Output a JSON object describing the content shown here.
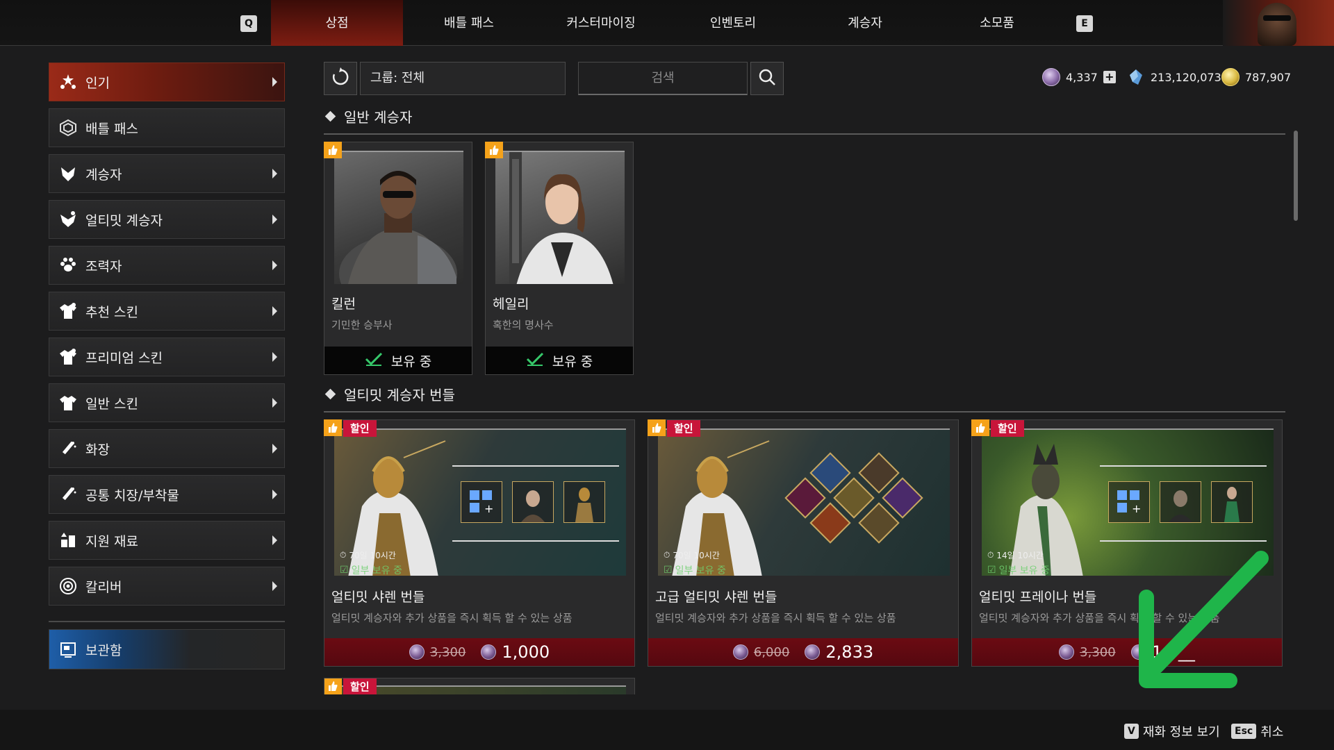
{
  "topbar": {
    "key_left": "Q",
    "key_right": "E",
    "tabs": [
      {
        "label": "상점",
        "active": true
      },
      {
        "label": "배틀 패스",
        "active": false
      },
      {
        "label": "커스터마이징",
        "active": false
      },
      {
        "label": "인벤토리",
        "active": false
      },
      {
        "label": "계승자",
        "active": false
      },
      {
        "label": "소모품",
        "active": false
      }
    ]
  },
  "sidebar": {
    "items": [
      {
        "label": "인기",
        "icon": "star-cluster-icon",
        "active": true,
        "has_arrow": true
      },
      {
        "label": "배틀 패스",
        "icon": "battle-pass-icon",
        "active": false,
        "has_arrow": false
      },
      {
        "label": "계승자",
        "icon": "descendant-icon",
        "active": false,
        "has_arrow": true
      },
      {
        "label": "얼티밋 계승자",
        "icon": "ultimate-descendant-icon",
        "active": false,
        "has_arrow": true
      },
      {
        "label": "조력자",
        "icon": "paw-icon",
        "active": false,
        "has_arrow": true
      },
      {
        "label": "추천 스킨",
        "icon": "shirt-icon",
        "active": false,
        "has_arrow": true
      },
      {
        "label": "프리미엄 스킨",
        "icon": "shirt-icon",
        "active": false,
        "has_arrow": true
      },
      {
        "label": "일반 스킨",
        "icon": "shirt-icon",
        "active": false,
        "has_arrow": true
      },
      {
        "label": "화장",
        "icon": "makeup-brush-icon",
        "active": false,
        "has_arrow": true
      },
      {
        "label": "공통 치장/부착물",
        "icon": "makeup-brush-icon",
        "active": false,
        "has_arrow": true
      },
      {
        "label": "지원 재료",
        "icon": "materials-icon",
        "active": false,
        "has_arrow": true
      },
      {
        "label": "칼리버",
        "icon": "caliber-icon",
        "active": false,
        "has_arrow": true
      }
    ],
    "storage_label": "보관함"
  },
  "toolbar": {
    "group_label": "그룹: 전체",
    "search_placeholder": "검색"
  },
  "currency": [
    {
      "value": "4,337",
      "icon": "caliber-coin-icon",
      "color": "#8a6aa8"
    },
    {
      "value": "213,120,073",
      "icon": "kuiper-shard-icon",
      "color": "#5a9ad8"
    },
    {
      "value": "787,907",
      "icon": "gold-coin-icon",
      "color": "#d8b840"
    }
  ],
  "sections": {
    "general": "일반 계승자",
    "ultimate": "얼티밋 계승자 번들"
  },
  "descendants": [
    {
      "name": "킬런",
      "subtitle": "기민한 승부사",
      "status": "보유 중"
    },
    {
      "name": "헤일리",
      "subtitle": "혹한의 명사수",
      "status": "보유 중"
    }
  ],
  "bundles": [
    {
      "sale_tag": "할인",
      "timer": "70일 10시간",
      "partial": "일부 보유 중",
      "title": "얼티밋 샤렌 번들",
      "desc": "얼티밋 계승자와 추가 상품을 즉시 획득 할 수 있는 상품",
      "old_price": "3,300",
      "new_price": "1,000"
    },
    {
      "sale_tag": "할인",
      "timer": "70일 10시간",
      "partial": "일부 보유 중",
      "title": "고급 얼티밋 샤렌 번들",
      "desc": "얼티밋 계승자와 추가 상품을 즉시 획득 할 수 있는 상품",
      "old_price": "6,000",
      "new_price": "2,833"
    },
    {
      "sale_tag": "할인",
      "timer": "14일 10시간",
      "partial": "일부 보유 중",
      "title": "얼티밋 프레이나 번들",
      "desc": "얼티밋 계승자와 추가 상품을 즉시 획득 할 수 있는 상품",
      "old_price": "3,300",
      "new_price": "1,0__"
    },
    {
      "sale_tag": "할인"
    }
  ],
  "bottom_hints": [
    {
      "key": "V",
      "label": "재화 정보 보기"
    },
    {
      "key": "Esc",
      "label": "취소"
    }
  ],
  "colors": {
    "accent_red": "#8a2014",
    "sale_red": "#c8153a",
    "badge_orange": "#f5a21a",
    "annotation_arrow": "#1fb54a"
  }
}
